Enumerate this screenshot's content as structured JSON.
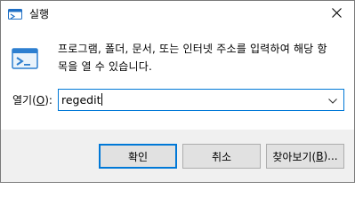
{
  "window": {
    "title": "실행",
    "close_glyph": "✕",
    "icon": "run-dialog-icon"
  },
  "description": {
    "line1": "프로그램, 폴더, 문서, 또는 인터넷 주소를 입력하여 해당 항",
    "line2": "목을 열 수 있습니다."
  },
  "open_field": {
    "label_prefix": "열기(",
    "label_hotkey": "O",
    "label_suffix": "):",
    "value": "regedit",
    "dropdown_icon": "chevron-down-icon"
  },
  "buttons": {
    "ok_label": "확인",
    "cancel_label": "취소",
    "browse_prefix": "찾아보기(",
    "browse_hotkey": "B",
    "browse_suffix": ")..."
  },
  "colors": {
    "accent": "#0078d7",
    "footer_bg": "#f0f0f0",
    "button_bg": "#e1e1e1"
  }
}
